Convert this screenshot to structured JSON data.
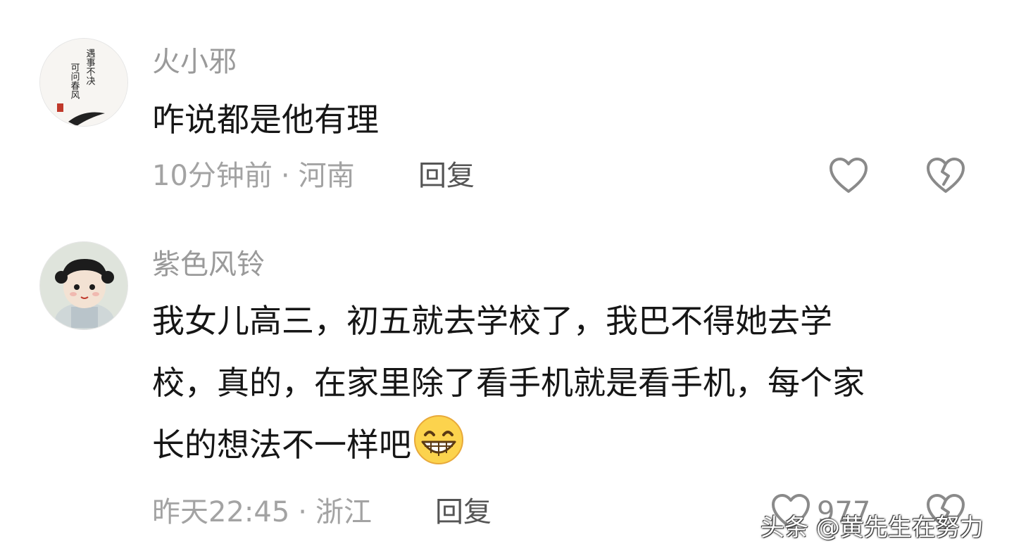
{
  "comments": [
    {
      "username": "火小邪",
      "content": "咋说都是他有理",
      "time": "10分钟前",
      "separator": "·",
      "location": "河南",
      "reply_label": "回复",
      "like_icon": "heart-outline-icon",
      "dislike_icon": "broken-heart-icon",
      "avatar_text": [
        "遇事不决",
        "可问春风"
      ]
    },
    {
      "username": "紫色风铃",
      "content_lines": [
        "我女儿高三，初五就去学校了，我巴不得她去学",
        "校，真的，在家里除了看手机就是看手机，每个家",
        "长的想法不一样吧"
      ],
      "emoji": "grinning-face-emoji",
      "time": "昨天22:45",
      "separator": "·",
      "location": "浙江",
      "reply_label": "回复",
      "like_count": "977",
      "like_icon": "heart-outline-icon",
      "dislike_icon": "broken-heart-icon"
    }
  ],
  "watermark": "头条 @黄先生在努力",
  "colors": {
    "username": "#9a9a9a",
    "content": "#161616",
    "meta": "#a3a3a3",
    "reply": "#555555",
    "icon": "#8a8a8a"
  }
}
